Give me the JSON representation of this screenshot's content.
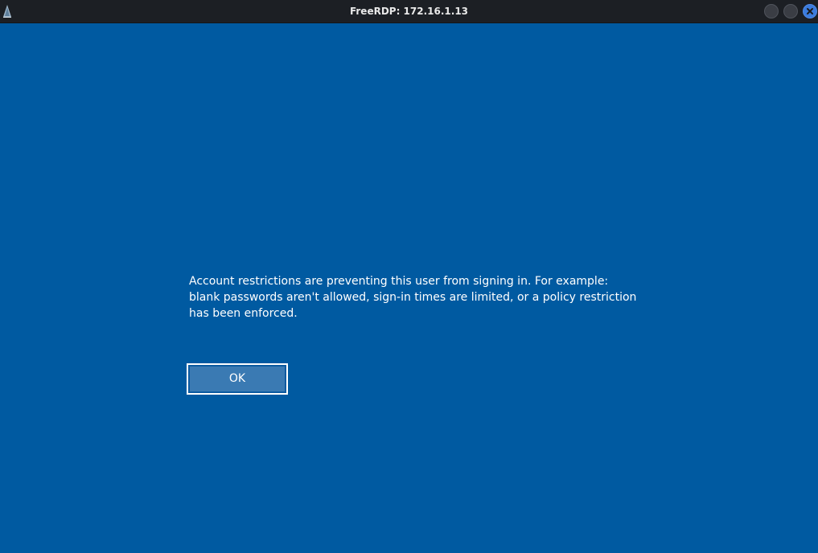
{
  "window": {
    "title": "FreeRDP: 172.16.1.13",
    "app_icon": "freerdp-icon",
    "controls": [
      "minimize-icon",
      "maximize-icon",
      "close-icon"
    ]
  },
  "dialog": {
    "message": "Account restrictions are preventing this user from signing in. For example: blank passwords aren't allowed, sign-in times are limited, or a policy restriction has been enforced.",
    "ok_label": "OK"
  },
  "colors": {
    "background": "#005aa1",
    "titlebar": "#1c1f24",
    "button_fill": "#3a7ab3",
    "close_button": "#3b7bdc",
    "text": "#ffffff"
  }
}
